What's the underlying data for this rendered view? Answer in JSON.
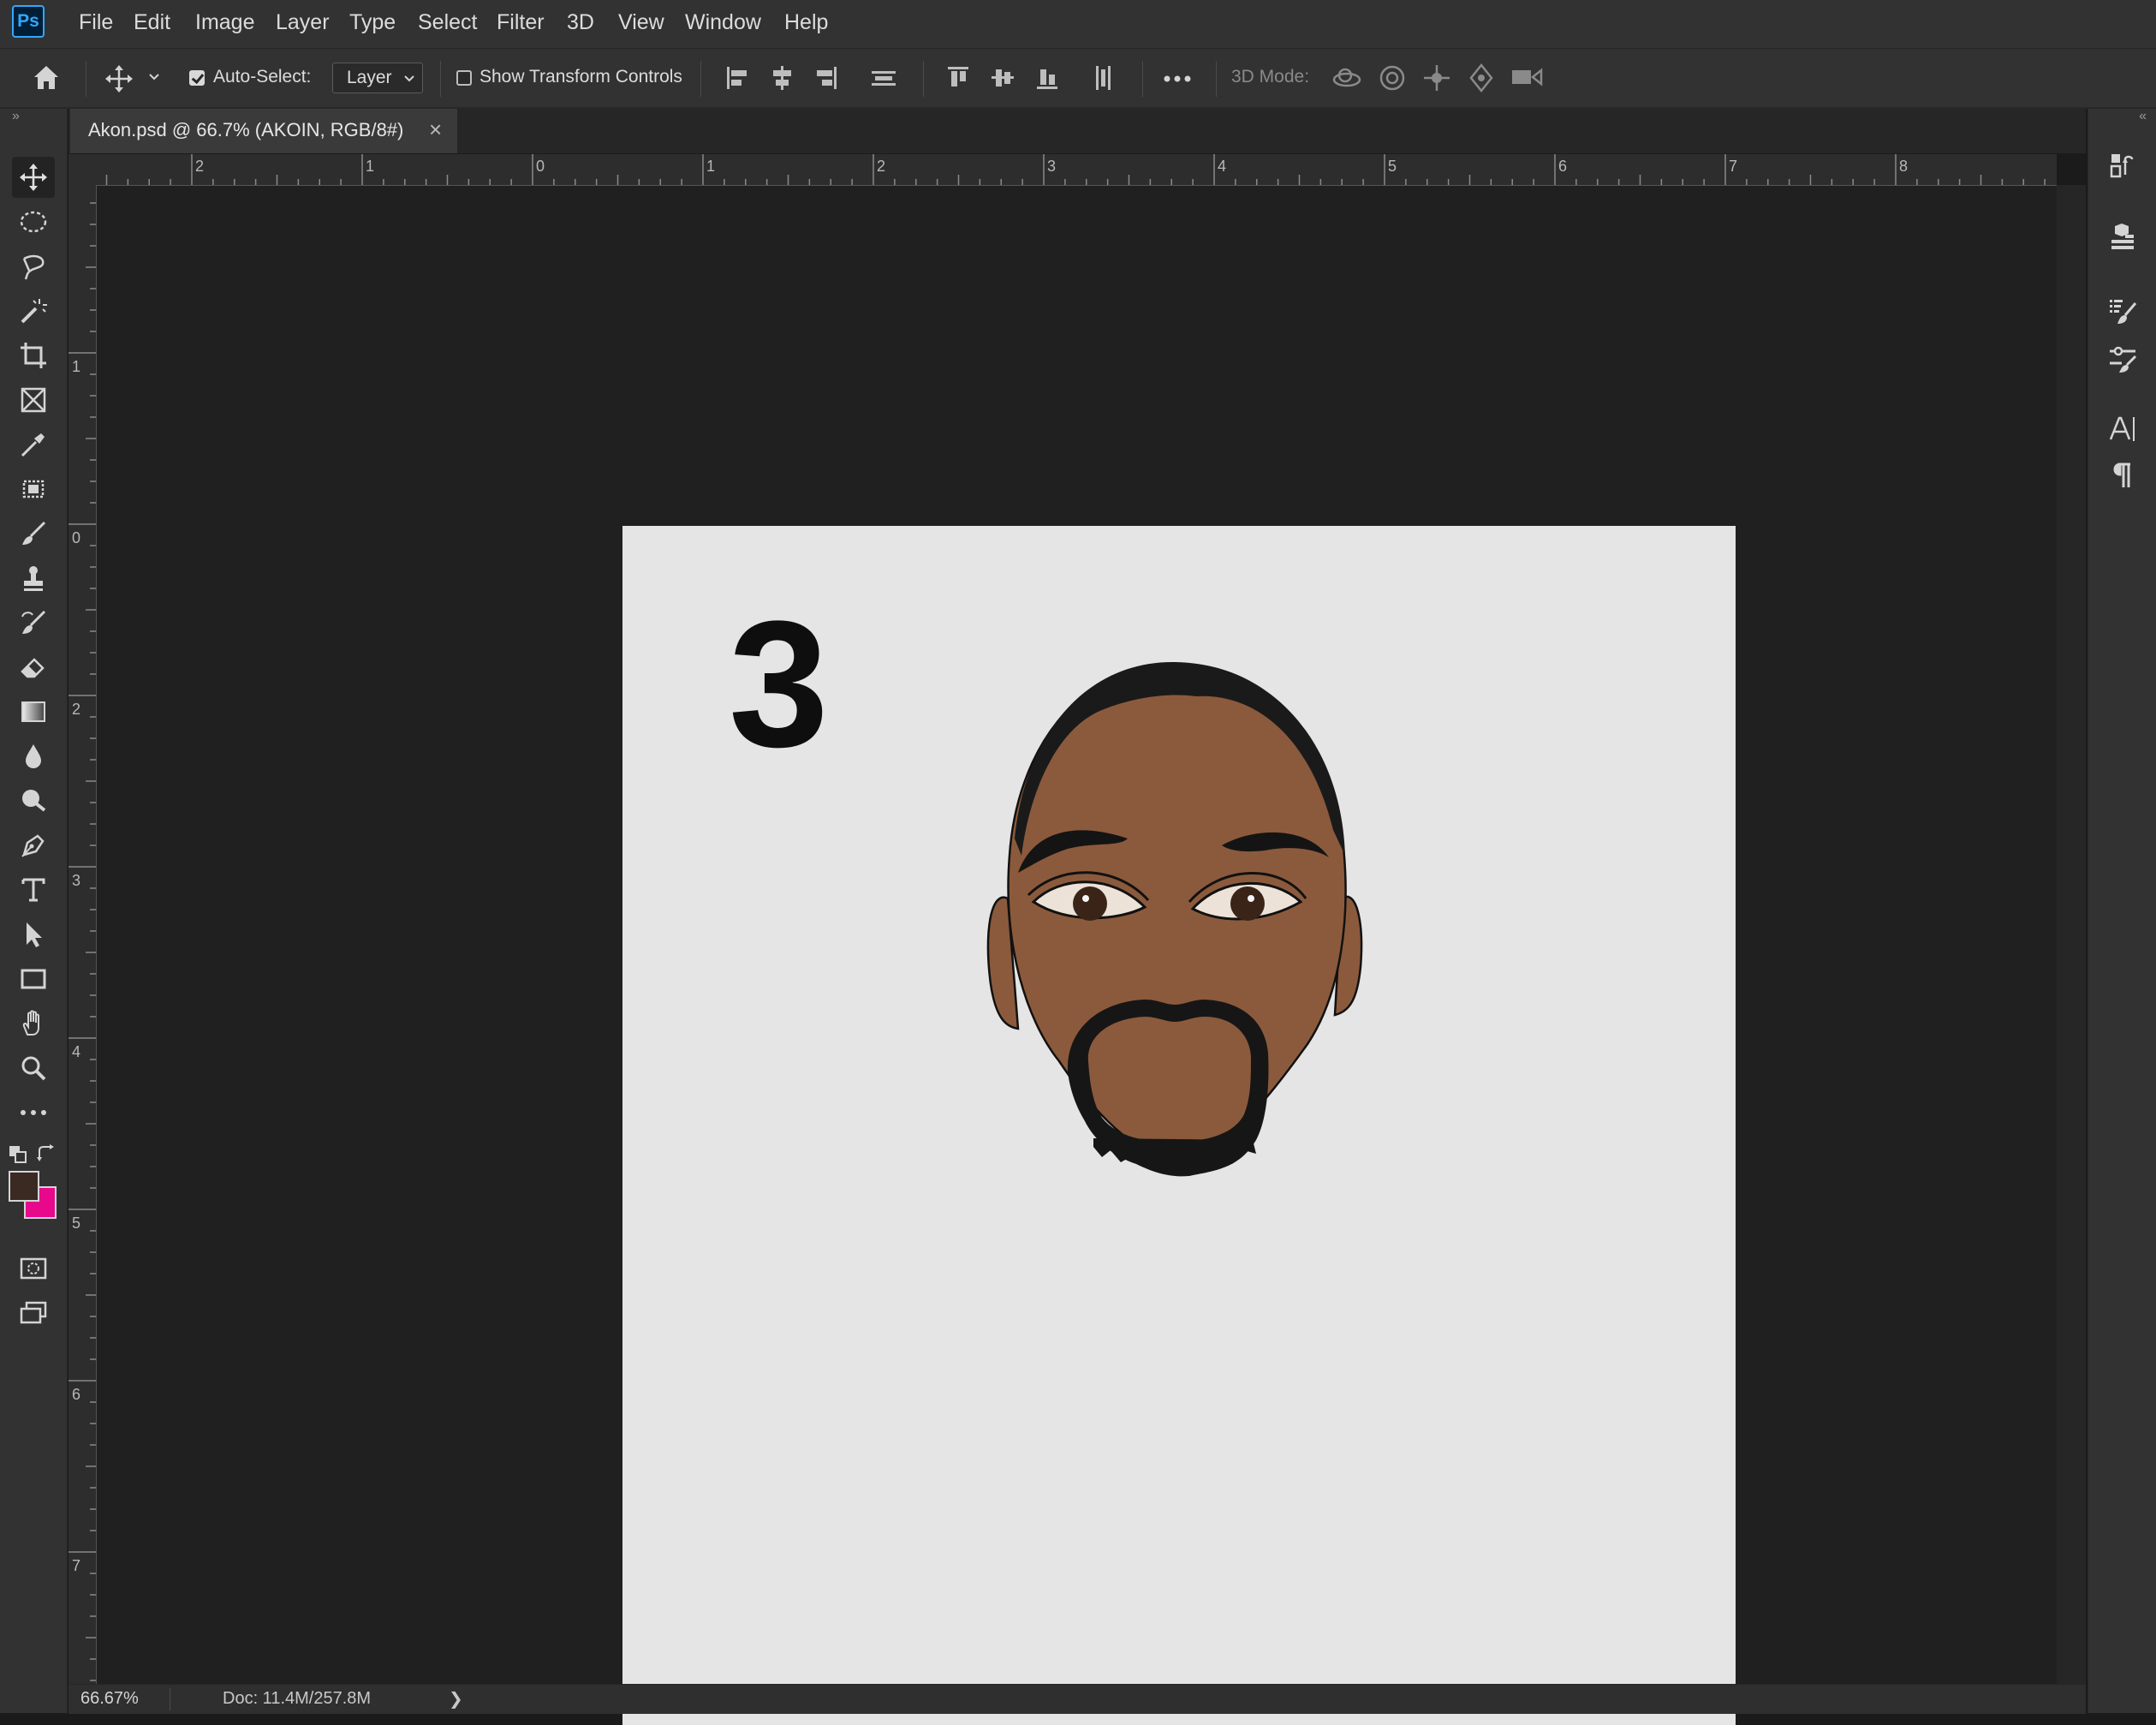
{
  "app": {
    "logo": "Ps"
  },
  "menu": [
    "File",
    "Edit",
    "Image",
    "Layer",
    "Type",
    "Select",
    "Filter",
    "3D",
    "View",
    "Window",
    "Help"
  ],
  "options": {
    "auto_select_label": "Auto-Select:",
    "auto_select_checked": true,
    "layer_select_value": "Layer",
    "show_transform_label": "Show Transform Controls",
    "show_transform_checked": false,
    "mode_3d_label": "3D Mode:"
  },
  "document": {
    "tab_title": "Akon.psd @ 66.7% (AKOIN, RGB/8#)",
    "close_glyph": "×",
    "big_number": "3"
  },
  "rulers": {
    "horizontal_labels": [
      "2",
      "1",
      "0",
      "1",
      "2",
      "3",
      "4",
      "5",
      "6",
      "7",
      "8"
    ],
    "vertical_labels": [
      "1",
      "0",
      "2",
      "3",
      "4",
      "5",
      "6",
      "7"
    ]
  },
  "status": {
    "zoom": "66.67%",
    "doc_info": "Doc: 11.4M/257.8M",
    "arrow": "❯"
  },
  "colors": {
    "foreground": "#3a2a22",
    "background": "#e8088c",
    "accent": "#31a8ff",
    "skin": "#8b5a3c"
  },
  "tools": [
    "move-tool",
    "marquee-tool",
    "lasso-tool",
    "magic-wand-tool",
    "crop-tool",
    "frame-tool",
    "eyedropper-tool",
    "healing-tool",
    "brush-tool",
    "stamp-tool",
    "history-brush-tool",
    "eraser-tool",
    "gradient-tool",
    "blur-tool",
    "dodge-tool",
    "pen-tool",
    "type-tool",
    "path-select-tool",
    "rectangle-tool",
    "hand-tool",
    "zoom-tool",
    "more-tools"
  ]
}
